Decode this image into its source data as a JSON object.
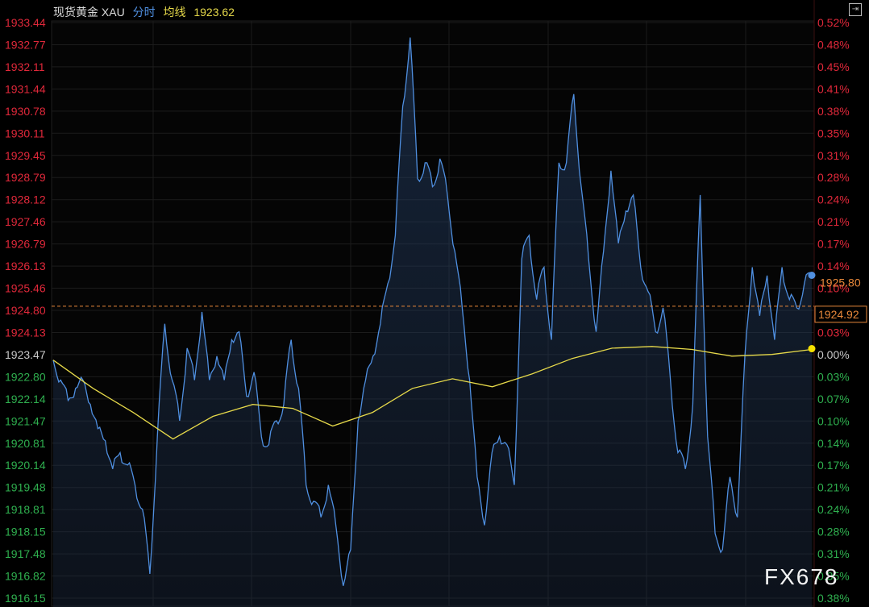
{
  "header": {
    "name": "现货黄金 XAU",
    "mode": "分时",
    "avg_label": "均线",
    "avg_value": "1923.62"
  },
  "watermark": "FX678",
  "colors": {
    "price": "#4f8fe0",
    "avg": "#e6d94a",
    "up": "#e0283a",
    "down": "#2fb04f",
    "neutral": "#c8c8c8",
    "ref": "#e8883a"
  },
  "chart_data": {
    "type": "line",
    "title": "现货黄金 XAU 分时",
    "prev_close": 1923.47,
    "ylim": [
      1916.15,
      1933.44
    ],
    "y_ticks": [
      "1933.44",
      "1932.77",
      "1932.11",
      "1931.44",
      "1930.78",
      "1930.11",
      "1929.45",
      "1928.79",
      "1928.12",
      "1927.46",
      "1926.79",
      "1926.13",
      "1925.46",
      "1924.80",
      "1924.13",
      "1923.47",
      "1922.80",
      "1922.14",
      "1921.47",
      "1920.81",
      "1920.14",
      "1919.48",
      "1918.81",
      "1918.15",
      "1917.48",
      "1916.82",
      "1916.15"
    ],
    "pct_ticks": [
      "0.52%",
      "0.48%",
      "0.45%",
      "0.41%",
      "0.38%",
      "0.35%",
      "0.31%",
      "0.28%",
      "0.24%",
      "0.21%",
      "0.17%",
      "0.14%",
      "0.10%",
      "0.07%",
      "0.03%",
      "0.00%",
      "0.03%",
      "0.07%",
      "0.10%",
      "0.14%",
      "0.17%",
      "0.21%",
      "0.24%",
      "0.28%",
      "0.31%",
      "0.35%",
      "0.38%"
    ],
    "last_price": "1925.80",
    "ref_price": "1924.92",
    "grid": true,
    "series": [
      {
        "name": "分时",
        "values": [
          1923.3,
          1922.7,
          1922.09,
          1922.45,
          1922.7,
          1921.97,
          1921.24,
          1920.88,
          1920.03,
          1920.52,
          1920.15,
          1919.55,
          1918.82,
          1916.88,
          1921.0,
          1924.39,
          1922.7,
          1921.48,
          1923.66,
          1922.7,
          1924.75,
          1922.7,
          1923.42,
          1922.7,
          1923.91,
          1924.15,
          1922.21,
          1922.94,
          1921.0,
          1920.76,
          1921.48,
          1921.97,
          1923.91,
          1922.45,
          1919.55,
          1919.06,
          1918.58,
          1919.55,
          1918.34,
          1916.52,
          1917.61,
          1921.48,
          1922.7,
          1923.42,
          1924.39,
          1925.6,
          1927.05,
          1930.93,
          1932.99,
          1928.75,
          1929.23,
          1928.51,
          1929.35,
          1928.26,
          1926.57,
          1924.87,
          1922.7,
          1919.79,
          1918.34,
          1920.52,
          1921.0,
          1920.76,
          1919.55,
          1926.33,
          1927.05,
          1925.12,
          1926.09,
          1923.91,
          1929.23,
          1929.23,
          1931.29,
          1928.51,
          1926.33,
          1924.15,
          1926.57,
          1928.99,
          1926.81,
          1927.78,
          1928.26,
          1926.09,
          1925.36,
          1924.15,
          1924.87,
          1922.7,
          1920.52,
          1920.03,
          1921.97,
          1928.26,
          1921.0,
          1918.09,
          1917.61,
          1919.79,
          1918.58,
          1923.42,
          1926.09,
          1924.63,
          1925.84,
          1923.91,
          1926.09,
          1925.12,
          1924.87,
          1925.6,
          1925.8
        ]
      },
      {
        "name": "均线",
        "values": [
          1923.3,
          1922.45,
          1921.73,
          1920.93,
          1921.61,
          1921.97,
          1921.85,
          1921.32,
          1921.73,
          1922.45,
          1922.74,
          1922.5,
          1922.89,
          1923.35,
          1923.66,
          1923.71,
          1923.62,
          1923.42,
          1923.47,
          1923.62
        ]
      }
    ]
  }
}
